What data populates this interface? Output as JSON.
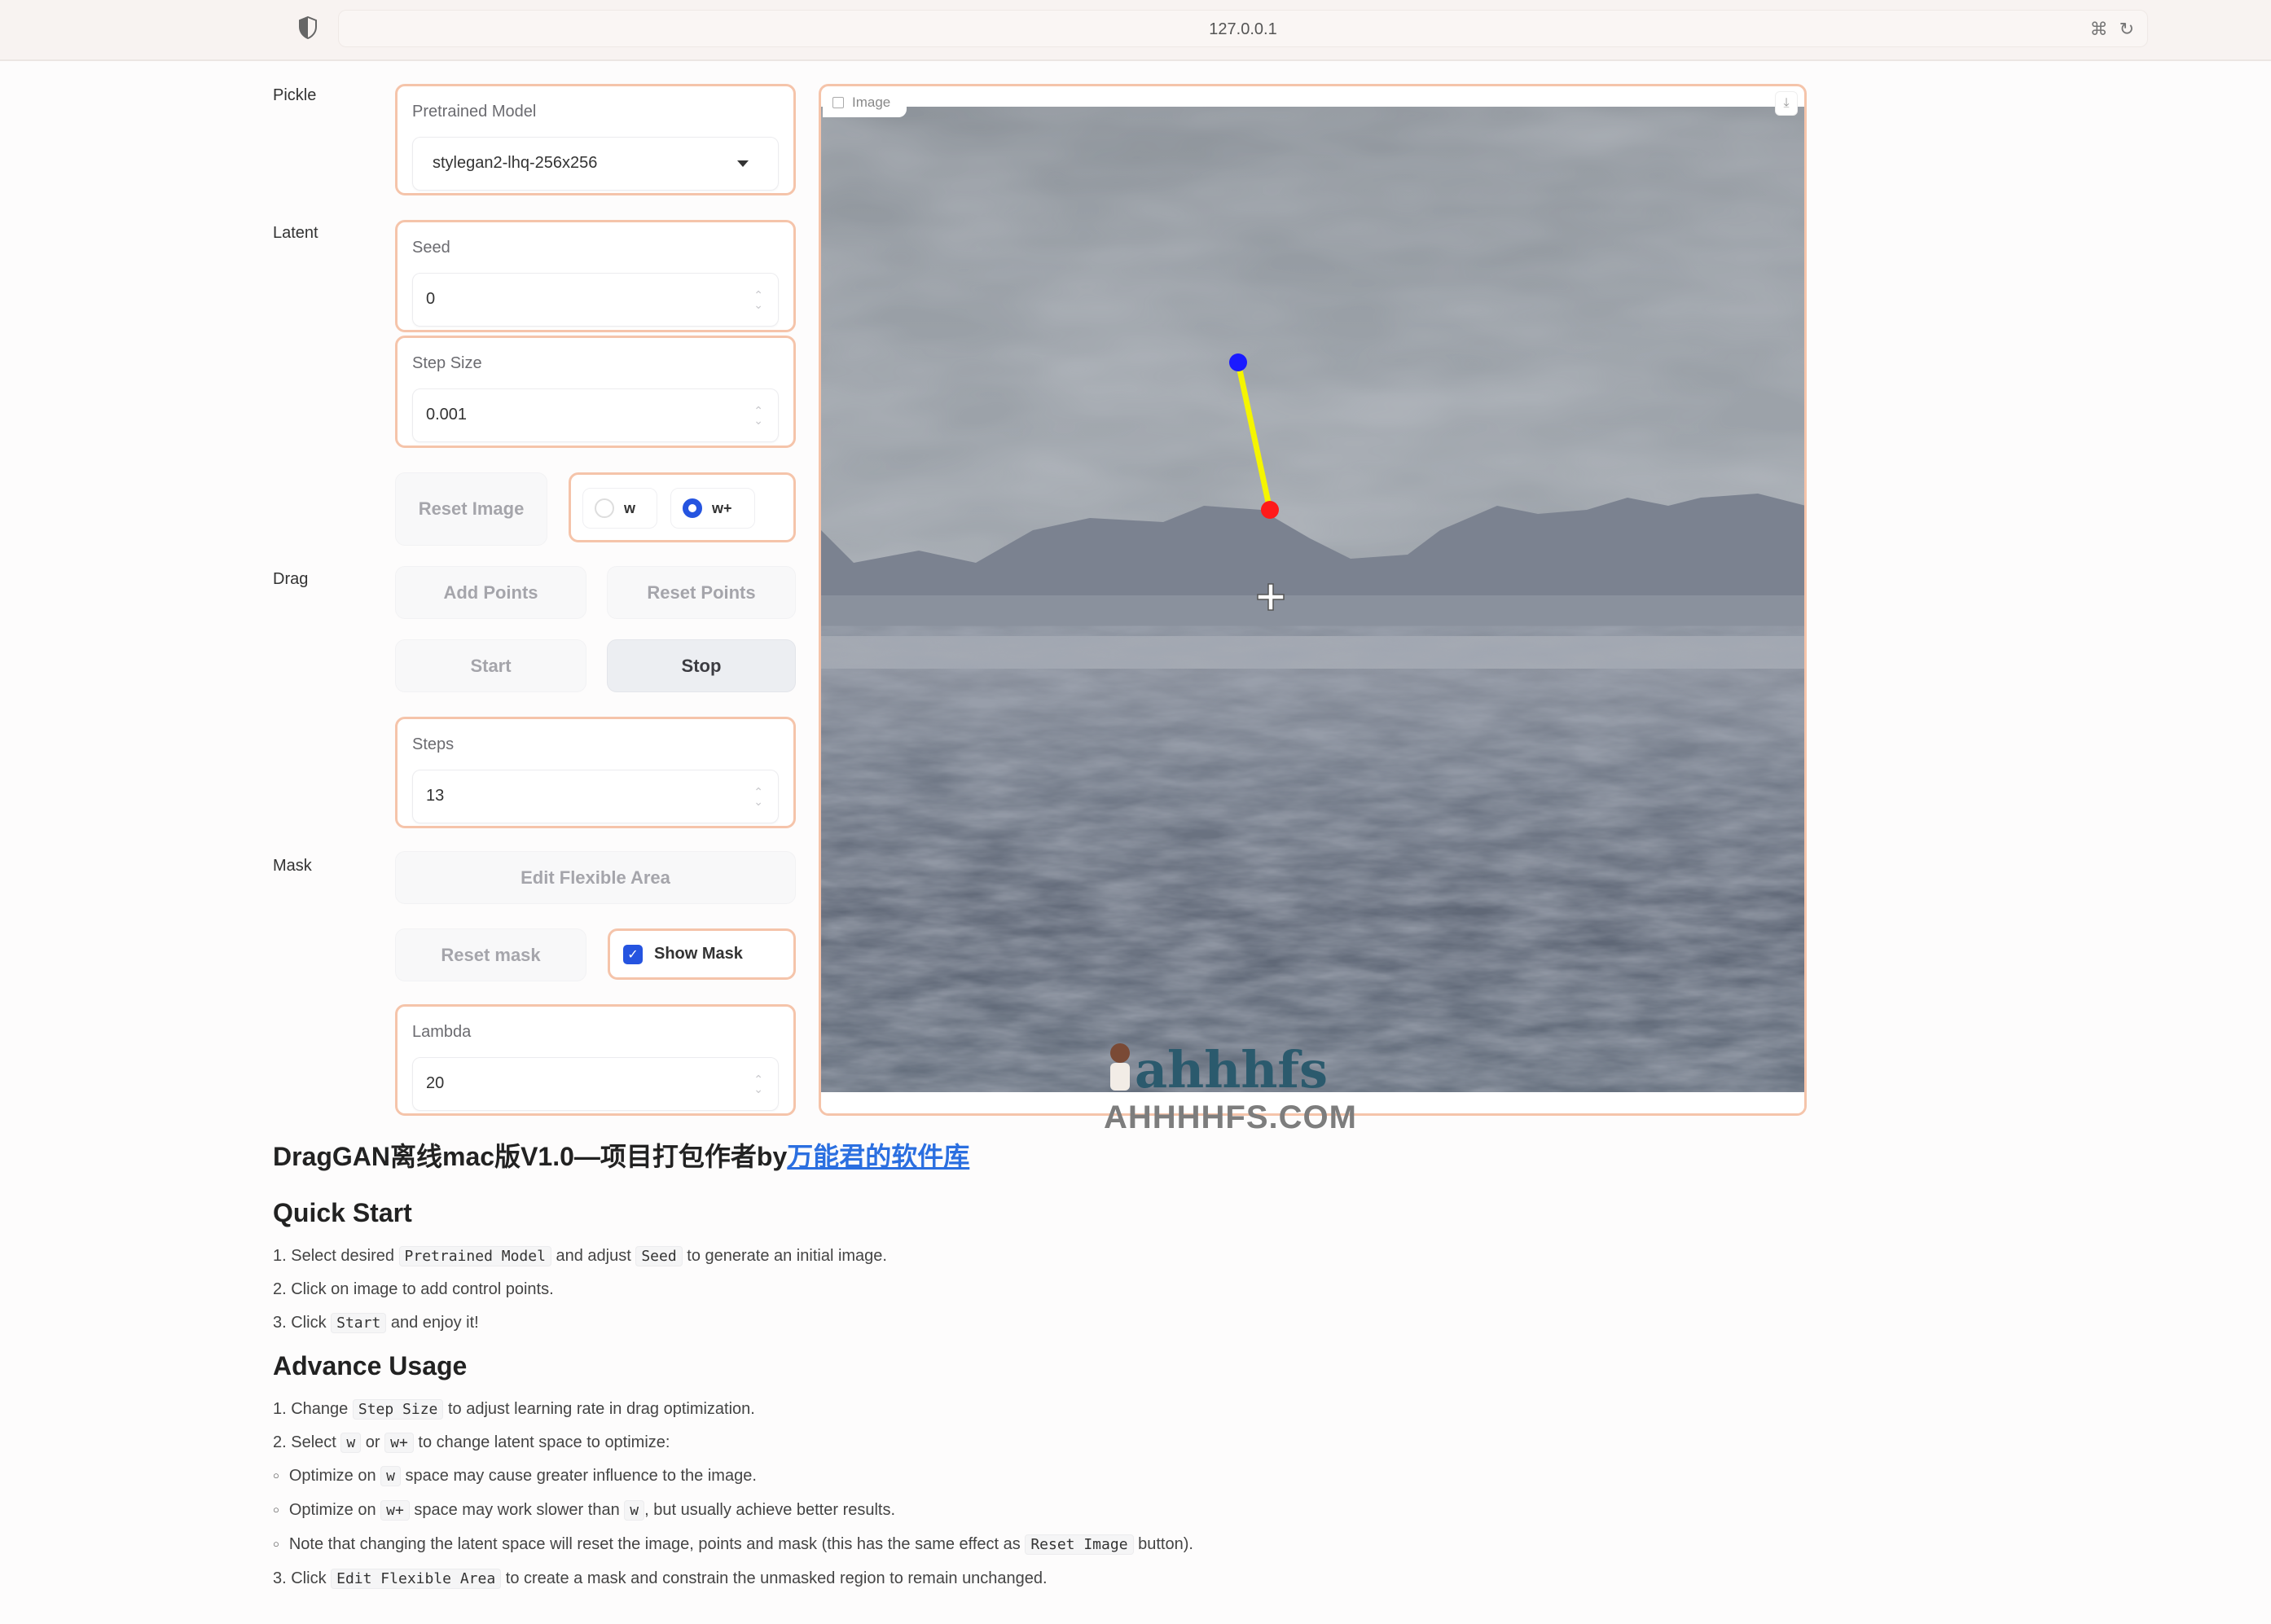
{
  "browser": {
    "url": "127.0.0.1",
    "icons": [
      "shield-icon",
      "translate-icon",
      "reload-icon"
    ]
  },
  "controls": {
    "pickle_label": "Pickle",
    "latent_label": "Latent",
    "drag_label": "Drag",
    "mask_label": "Mask",
    "pretrained_model": {
      "label": "Pretrained Model",
      "value": "stylegan2-lhq-256x256"
    },
    "seed": {
      "label": "Seed",
      "value": "0"
    },
    "step_size": {
      "label": "Step Size",
      "value": "0.001"
    },
    "reset_image": "Reset Image",
    "latent_space": {
      "options": [
        "w",
        "w+"
      ],
      "selected": "w+"
    },
    "add_points": "Add Points",
    "reset_points": "Reset Points",
    "start": "Start",
    "stop": "Stop",
    "steps": {
      "label": "Steps",
      "value": "13"
    },
    "edit_flexible_area": "Edit Flexible Area",
    "reset_mask": "Reset mask",
    "show_mask": {
      "label": "Show Mask",
      "checked": true
    },
    "lambda": {
      "label": "Lambda",
      "value": "20"
    }
  },
  "image_panel": {
    "label": "Image",
    "handle_point_color": "#1a1aff",
    "target_point_color": "#ff1a1a",
    "line_color": "#f5f500",
    "watermark": "AHHHHFS.COM",
    "watermark_logo": "ahhhfs"
  },
  "docs": {
    "title_prefix": "DragGAN离线mac版V1.0—项目打包作者by",
    "title_link": "万能君的软件库",
    "quick_start": {
      "heading": "Quick Start",
      "items": [
        {
          "pre": "1. Select desired ",
          "code1": "Pretrained Model",
          "mid": " and adjust ",
          "code2": "Seed",
          "post": " to generate an initial image."
        },
        {
          "text": "2. Click on image to add control points."
        },
        {
          "pre": "3. Click ",
          "code1": "Start",
          "post": " and enjoy it!"
        }
      ]
    },
    "advance_usage": {
      "heading": "Advance Usage",
      "item1": {
        "pre": "1. Change ",
        "code": "Step Size",
        "post": " to adjust learning rate in drag optimization."
      },
      "item2": {
        "pre": "2. Select ",
        "code1": "w",
        "mid": " or ",
        "code2": "w+",
        "post": " to change latent space to optimize:"
      },
      "sub1": {
        "pre": "Optimize on ",
        "code": "w",
        "post": " space may cause greater influence to the image."
      },
      "sub2": {
        "pre": "Optimize on ",
        "code1": "w+",
        "mid": " space may work slower than ",
        "code2": "w",
        "post": ", but usually achieve better results."
      },
      "sub3": {
        "pre": "Note that changing the latent space will reset the image, points and mask (this has the same effect as ",
        "code": "Reset Image",
        "post": " button)."
      },
      "item3": {
        "pre": "3. Click ",
        "code": "Edit Flexible Area",
        "post": " to create a mask and constrain the unmasked region to remain unchanged."
      }
    }
  }
}
